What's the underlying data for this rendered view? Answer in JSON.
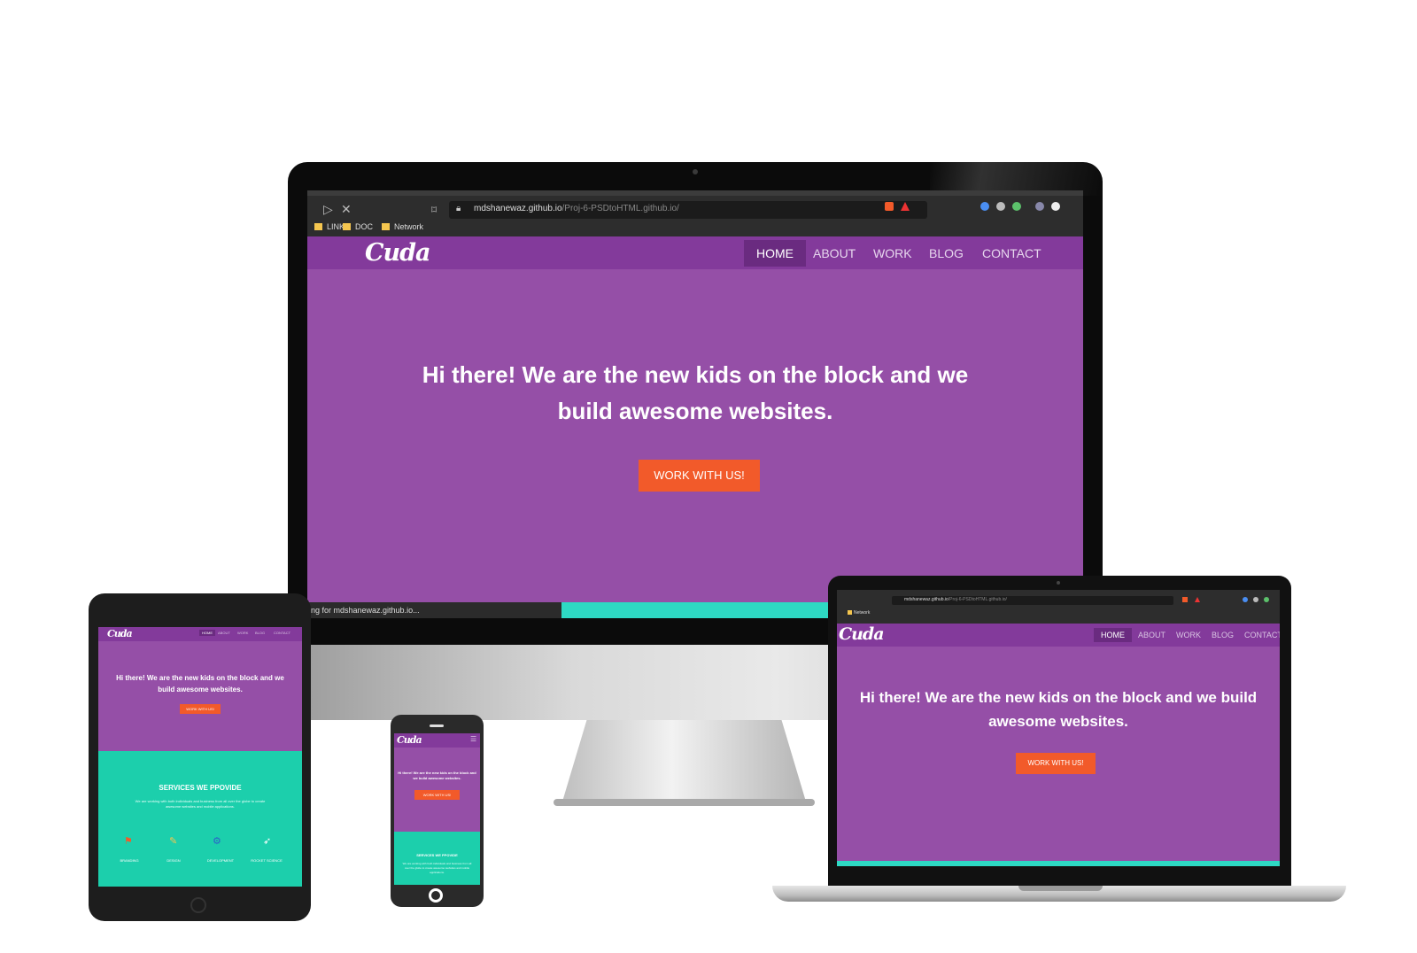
{
  "colors": {
    "purple": "#954fa7",
    "nav_purple": "#833a9b",
    "orange": "#f25a2a",
    "teal": "#1ccfac"
  },
  "browser": {
    "url_host": "mdshanewaz.github.io",
    "url_path": "/Proj-6-PSDtoHTML.github.io/",
    "bookmarks": [
      "LINK",
      "DOC",
      "Network"
    ],
    "status": "ing for mdshanewaz.github.io..."
  },
  "site": {
    "logo": "Cuda",
    "nav": [
      "HOME",
      "ABOUT",
      "WORK",
      "BLOG",
      "CONTACT"
    ],
    "hero_title": "Hi there! We are the new kids on the block and we build awesome websites.",
    "hero_button": "WORK WITH US!",
    "services_title": "SERVICES WE PPOVIDE",
    "services_desc": "We are working with both individuals and business from all over the globe to create awesome websites and mobile applications.",
    "services": [
      "BRANDING",
      "DESIGN",
      "DEVELOPMENT",
      "ROCKET SCIENCE"
    ]
  },
  "laptop": {
    "bookmark": "Network"
  },
  "icons": [
    "apple-logo",
    "lock-icon",
    "bookmark-icon",
    "folder-icon",
    "close-icon",
    "forward-icon",
    "home-button-icon",
    "hamburger-icon",
    "flag-icon",
    "pencil-icon",
    "gears-icon",
    "rocket-icon"
  ]
}
